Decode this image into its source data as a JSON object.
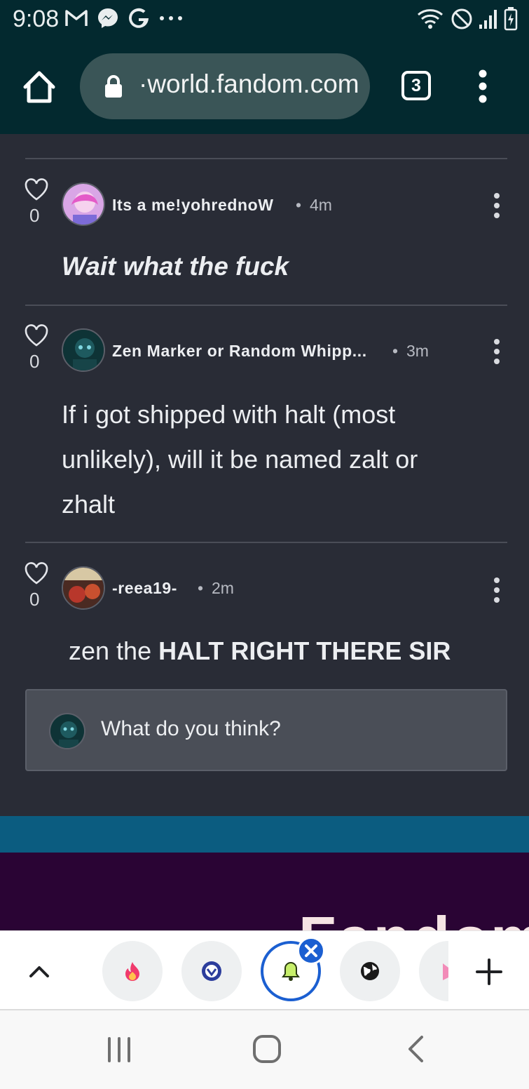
{
  "status_bar": {
    "time": "9:08",
    "left_icons": [
      "gmail-icon",
      "messenger-icon",
      "google-icon",
      "more-notifications-icon"
    ],
    "right_icons": [
      "wifi-icon",
      "do-not-disturb-icon",
      "signal-icon",
      "battery-charging-icon"
    ]
  },
  "browser": {
    "url": "·world.fandom.com",
    "tab_count": "3"
  },
  "comments": [
    {
      "likes": "0",
      "author": "Its a me!yohrednoW",
      "time": "4m",
      "text": "Wait what the fuck"
    },
    {
      "likes": "0",
      "author": "Zen Marker or Random Whipp...",
      "time": "3m",
      "text_lines": [
        "If i got shipped with halt (most",
        "unlikely), will it be named zalt or",
        "zhalt"
      ]
    },
    {
      "likes": "0",
      "author": "-reea19-",
      "time": "2m",
      "text_normal": "zen the ",
      "text_bold": "HALT RIGHT THERE SIR"
    }
  ],
  "separator": "•",
  "reply": {
    "placeholder": "What do you think?"
  },
  "footer": {
    "logo_text": "Fandom"
  },
  "tab_strip": {
    "tabs": [
      "fire-icon",
      "shield-badge-icon",
      "bell-icon",
      "globe-icon",
      "partial-tab-icon"
    ],
    "active_index": 2
  },
  "colors": {
    "toolbar_bg": "#03292f",
    "content_bg": "#292c36",
    "active_tab": "#1b5fd1",
    "footer_band": "#0b5c80",
    "footer_purple": "#2a0434"
  }
}
